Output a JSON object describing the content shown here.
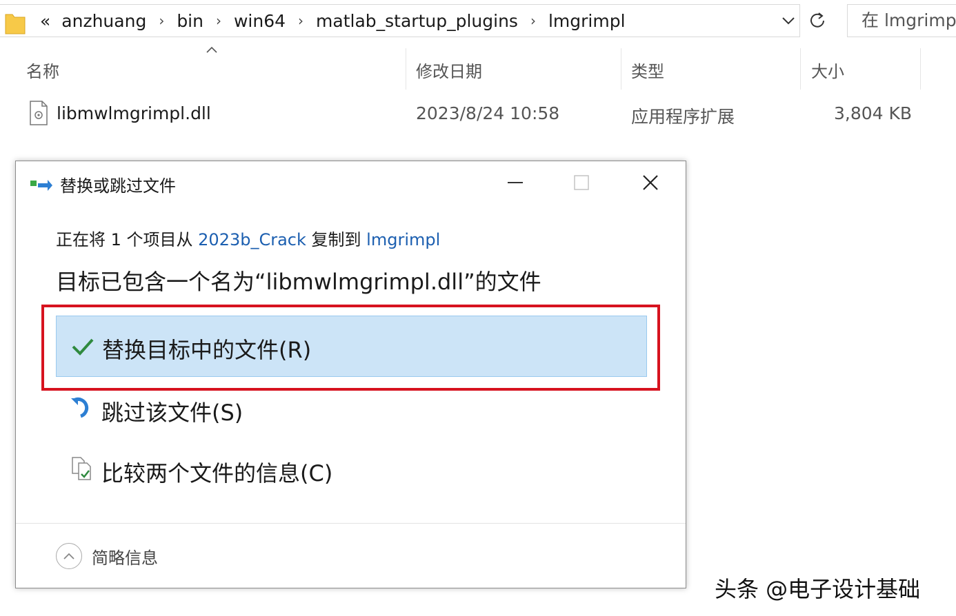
{
  "address_bar": {
    "overflow": "«",
    "crumbs": [
      "anzhuang",
      "bin",
      "win64",
      "matlab_startup_plugins",
      "lmgrimpl"
    ],
    "separator": "›"
  },
  "search": {
    "text": "在 lmgrimp"
  },
  "columns": {
    "name": "名称",
    "date": "修改日期",
    "type": "类型",
    "size": "大小"
  },
  "file": {
    "name": "libmwlmgrimpl.dll",
    "date": "2023/8/24 10:58",
    "type": "应用程序扩展",
    "size": "3,804 KB"
  },
  "dialog": {
    "title": "替换或跳过文件",
    "copy_prefix": "正在将 1 个项目从 ",
    "source": "2023b_Crack",
    "copy_mid": " 复制到 ",
    "dest": "lmgrimpl",
    "conflict_message": "目标已包含一个名为“libmwlmgrimpl.dll”的文件",
    "options": {
      "replace": "替换目标中的文件(R)",
      "skip": "跳过该文件(S)",
      "compare": "比较两个文件的信息(C)"
    },
    "more_info": "简略信息"
  },
  "watermark": "头条 @电子设计基础",
  "colors": {
    "highlight_bg": "#cce4f7",
    "highlight_border": "#d7131f",
    "link": "#1c5fb0"
  }
}
